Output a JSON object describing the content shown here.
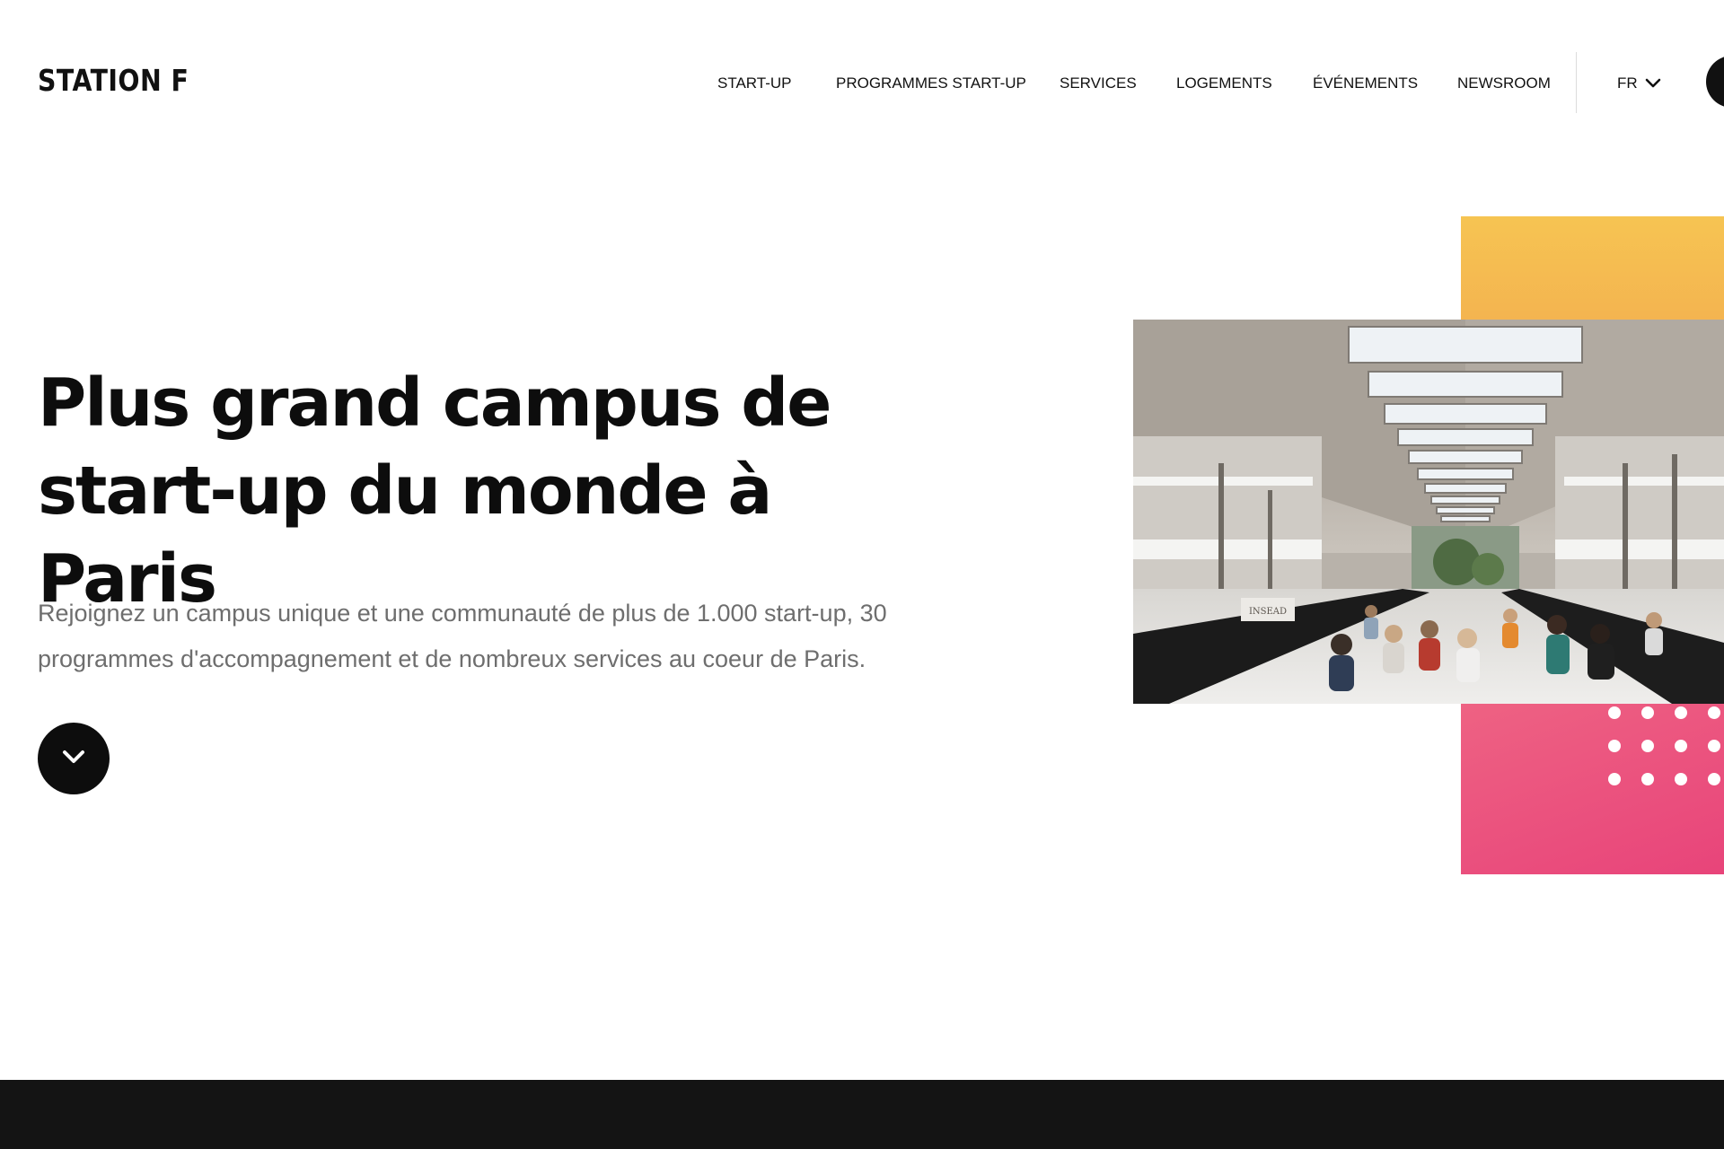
{
  "header": {
    "logo_text": "STATION F",
    "nav": [
      {
        "label": "START-UP"
      },
      {
        "label": "PROGRAMMES START-UP"
      },
      {
        "label": "SERVICES"
      },
      {
        "label": "LOGEMENTS"
      },
      {
        "label": "ÉVÉNEMENTS"
      },
      {
        "label": "NEWSROOM"
      }
    ],
    "language": {
      "label": "FR",
      "icon": "chevron-down-icon"
    }
  },
  "hero": {
    "title": "Plus grand campus de start-up du monde à Paris",
    "description": "Rejoignez un campus unique et une communauté de plus de 1.000 start-up, 30 programmes d'accompagnement et de nombreux services au coeur de Paris.",
    "scroll_button_icon": "chevron-down-icon",
    "image": {
      "subject": "campus-hall-photo",
      "signage_text": "INSEAD"
    }
  },
  "colors": {
    "text": "#111111",
    "muted_text": "#6e6e6e",
    "accent_yellow": "#f6c452",
    "accent_pink": "#e8447a",
    "footer": "#141414"
  }
}
